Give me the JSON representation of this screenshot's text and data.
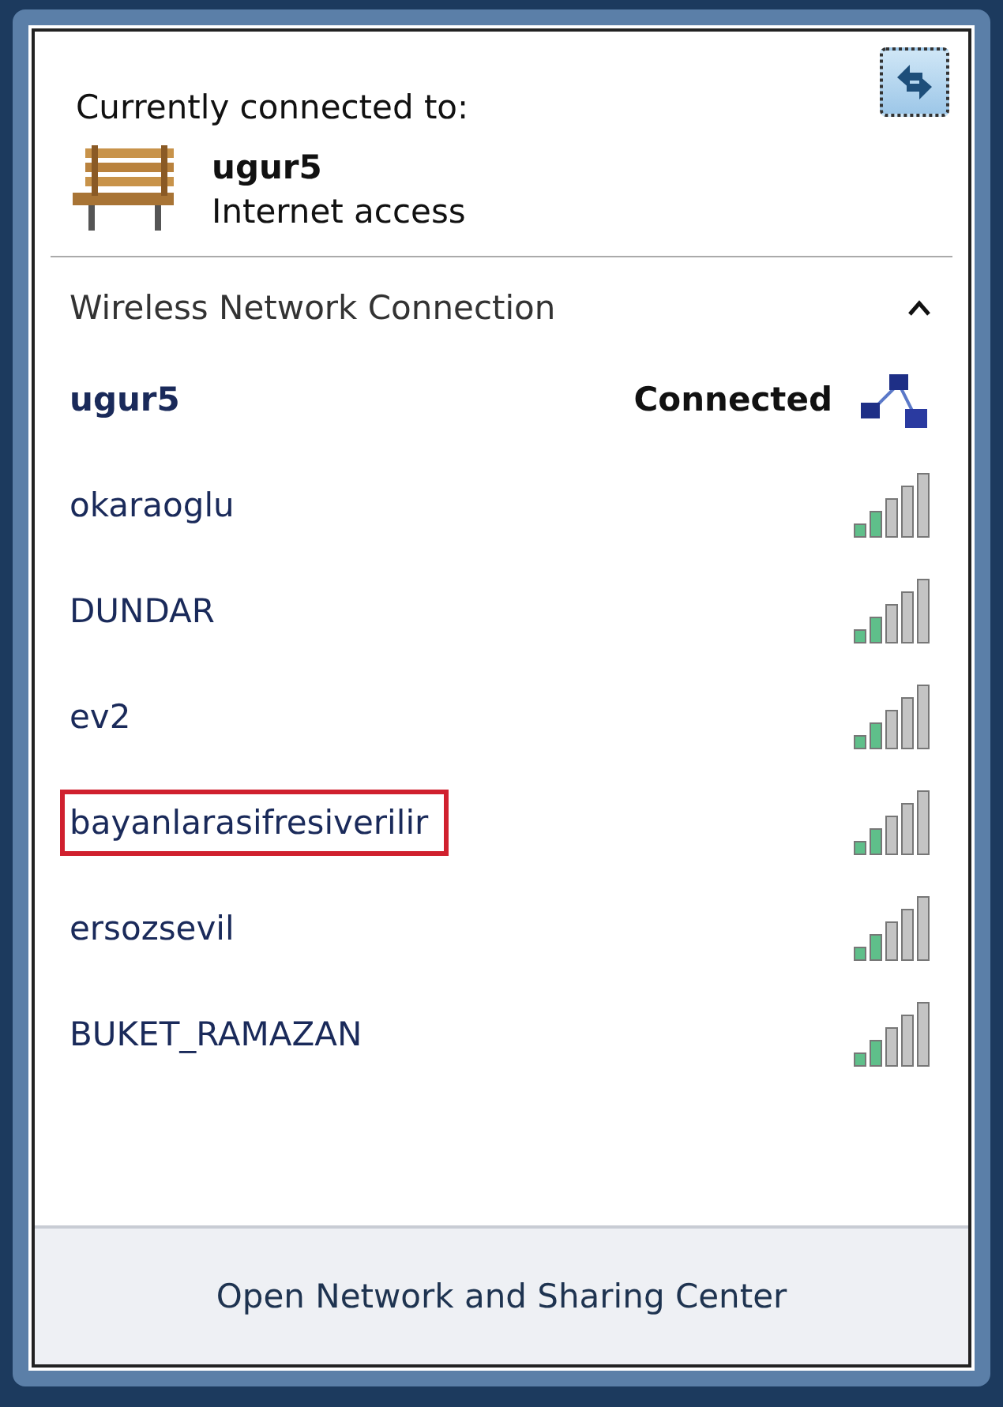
{
  "header": {
    "title": "Currently connected to:"
  },
  "current": {
    "name": "ugur5",
    "status": "Internet access"
  },
  "section": {
    "title": "Wireless Network Connection",
    "expanded": true
  },
  "networks": [
    {
      "name": "ugur5",
      "connected": true,
      "status": "Connected",
      "highlighted": false
    },
    {
      "name": "okaraoglu",
      "connected": false,
      "highlighted": false
    },
    {
      "name": "DUNDAR",
      "connected": false,
      "highlighted": false
    },
    {
      "name": "ev2",
      "connected": false,
      "highlighted": false
    },
    {
      "name": "bayanlarasifresiverilir",
      "connected": false,
      "highlighted": true
    },
    {
      "name": "ersozsevil",
      "connected": false,
      "highlighted": false
    },
    {
      "name": "BUKET_RAMAZAN",
      "connected": false,
      "highlighted": false
    }
  ],
  "footer": {
    "link": "Open Network and Sharing Center"
  }
}
